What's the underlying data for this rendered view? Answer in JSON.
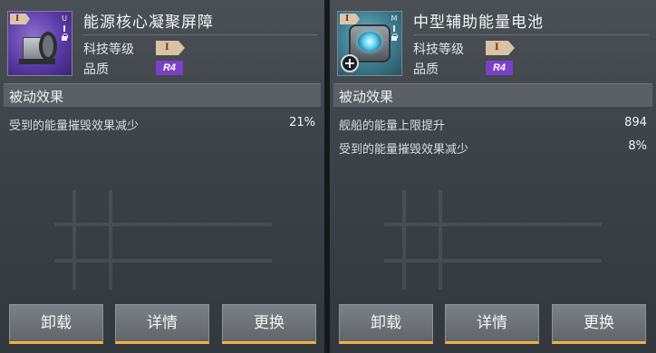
{
  "left": {
    "name": "能源核心凝聚屏障",
    "icon": "energy-core-generator",
    "tier_label": "I",
    "slot_letter": "U",
    "tech_level_label": "科技等级",
    "tech_level_value": "I",
    "quality_label": "品质",
    "quality_value": "R4",
    "section_title": "被动效果",
    "effects": [
      {
        "label": "受到的能量摧毁效果减少",
        "value": "21%"
      }
    ],
    "buttons": {
      "unequip": "卸载",
      "details": "详情",
      "replace": "更换"
    }
  },
  "right": {
    "name": "中型辅助能量电池",
    "icon": "energy-battery",
    "tier_label": "I",
    "slot_letter": "M",
    "tech_level_label": "科技等级",
    "tech_level_value": "I",
    "quality_label": "品质",
    "quality_value": "R4",
    "section_title": "被动效果",
    "effects": [
      {
        "label": "舰船的能量上限提升",
        "value": "894"
      },
      {
        "label": "受到的能量摧毁效果减少",
        "value": "8%"
      }
    ],
    "buttons": {
      "unequip": "卸载",
      "details": "详情",
      "replace": "更换"
    }
  },
  "colors": {
    "quality_r4": "#7b3fc8",
    "button_accent": "#f0b33c"
  }
}
